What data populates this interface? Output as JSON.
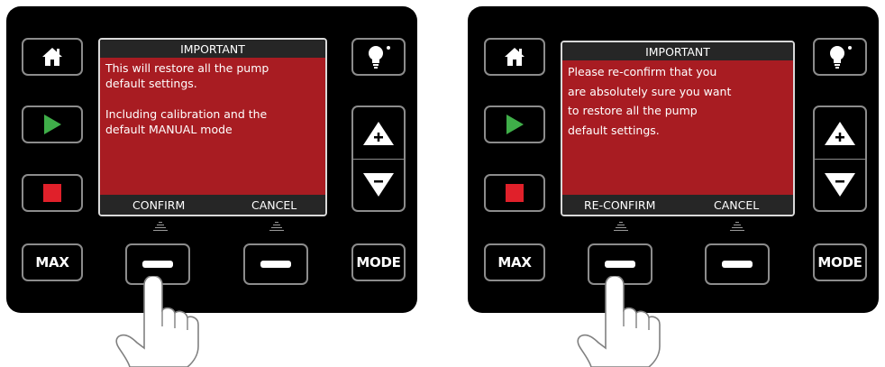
{
  "panels": [
    {
      "screen": {
        "title": "IMPORTANT",
        "message": "This will restore all the pump\ndefault settings.\n\nIncluding calibration and the\ndefault MANUAL mode",
        "soft_left_label": "CONFIRM",
        "soft_right_label": "CANCEL"
      },
      "max_label": "MAX",
      "mode_label": "MODE"
    },
    {
      "screen": {
        "title": "IMPORTANT",
        "message": "Please re-confirm that you\nare absolutely sure you want\nto restore all the pump\ndefault settings.",
        "soft_left_label": "RE-CONFIRM",
        "soft_right_label": "CANCEL"
      },
      "max_label": "MAX",
      "mode_label": "MODE"
    }
  ],
  "colors": {
    "panel_bg": "#000000",
    "screen_alert": "#a81c22",
    "play": "#3fae49",
    "stop": "#e0202a",
    "key_border": "#8c8c8c"
  },
  "icons": [
    "home-icon",
    "play-icon",
    "stop-icon",
    "bulb-icon",
    "plus-arrow-up-icon",
    "minus-arrow-down-icon",
    "minus-icon",
    "pointing-hand-icon"
  ]
}
